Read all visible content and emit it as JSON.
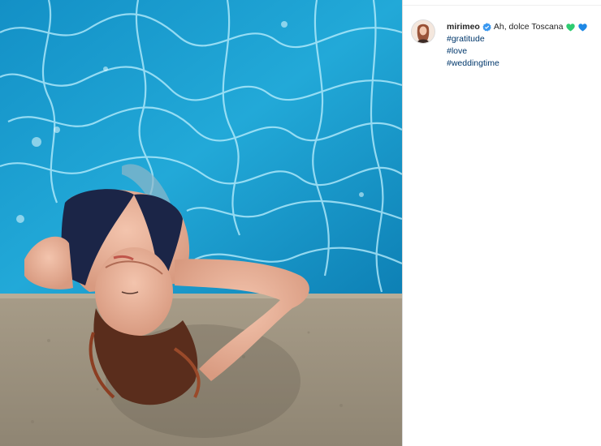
{
  "post": {
    "username": "mirimeo",
    "caption_text": "Ah, dolce Toscana",
    "hearts": [
      {
        "icon": "green-heart-icon",
        "color": "#2ecc71"
      },
      {
        "icon": "blue-heart-icon",
        "color": "#1e88e5"
      }
    ],
    "hashtags": [
      "#gratitude",
      "#love",
      "#weddingtime"
    ]
  },
  "colors": {
    "hashtag": "#00376b",
    "verified": "#3897f0",
    "pool": "#1d9fd0"
  }
}
